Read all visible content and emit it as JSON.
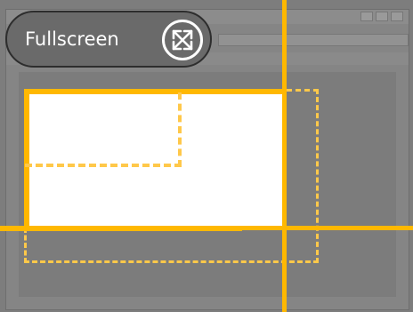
{
  "overlay": {
    "fullscreen_label": "Fullscreen",
    "fullscreen_icon": "fullscreen-expand-icon"
  },
  "colors": {
    "accent": "#ffb800",
    "accent_dashed": "#ffc84a",
    "overlay_bg": "#7d7d7d",
    "pill_bg": "#6a6a6a",
    "pill_border": "#2d2d2d",
    "preview_fill": "#ffffff"
  }
}
